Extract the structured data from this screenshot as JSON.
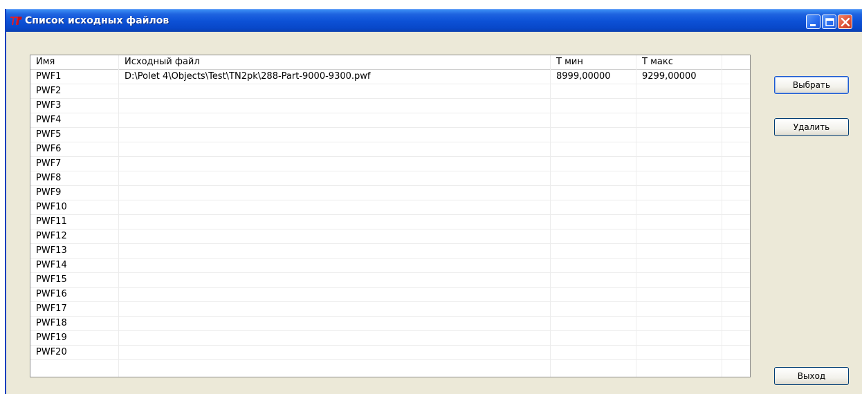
{
  "window": {
    "title": "Список исходных файлов",
    "icon": "app-logo-icon",
    "accent_color": "#0d52d7"
  },
  "titlebar_buttons": [
    "minimize-icon",
    "maximize-icon",
    "close-icon"
  ],
  "table": {
    "columns": [
      "Имя",
      "Исходный файл",
      "Т мин",
      "Т макс"
    ],
    "rows": [
      {
        "name": "PWF1",
        "file": "D:\\Polet 4\\Objects\\Test\\TN2pk\\288-Part-9000-9300.pwf",
        "tmin": "8999,00000",
        "tmax": "9299,00000"
      },
      {
        "name": "PWF2",
        "file": "",
        "tmin": "",
        "tmax": ""
      },
      {
        "name": "PWF3",
        "file": "",
        "tmin": "",
        "tmax": ""
      },
      {
        "name": "PWF4",
        "file": "",
        "tmin": "",
        "tmax": ""
      },
      {
        "name": "PWF5",
        "file": "",
        "tmin": "",
        "tmax": ""
      },
      {
        "name": "PWF6",
        "file": "",
        "tmin": "",
        "tmax": ""
      },
      {
        "name": "PWF7",
        "file": "",
        "tmin": "",
        "tmax": ""
      },
      {
        "name": "PWF8",
        "file": "",
        "tmin": "",
        "tmax": ""
      },
      {
        "name": "PWF9",
        "file": "",
        "tmin": "",
        "tmax": ""
      },
      {
        "name": "PWF10",
        "file": "",
        "tmin": "",
        "tmax": ""
      },
      {
        "name": "PWF11",
        "file": "",
        "tmin": "",
        "tmax": ""
      },
      {
        "name": "PWF12",
        "file": "",
        "tmin": "",
        "tmax": ""
      },
      {
        "name": "PWF13",
        "file": "",
        "tmin": "",
        "tmax": ""
      },
      {
        "name": "PWF14",
        "file": "",
        "tmin": "",
        "tmax": ""
      },
      {
        "name": "PWF15",
        "file": "",
        "tmin": "",
        "tmax": ""
      },
      {
        "name": "PWF16",
        "file": "",
        "tmin": "",
        "tmax": ""
      },
      {
        "name": "PWF17",
        "file": "",
        "tmin": "",
        "tmax": ""
      },
      {
        "name": "PWF18",
        "file": "",
        "tmin": "",
        "tmax": ""
      },
      {
        "name": "PWF19",
        "file": "",
        "tmin": "",
        "tmax": ""
      },
      {
        "name": "PWF20",
        "file": "",
        "tmin": "",
        "tmax": ""
      }
    ]
  },
  "buttons": {
    "select": "Выбрать",
    "delete": "Удалить",
    "exit": "Выход"
  }
}
